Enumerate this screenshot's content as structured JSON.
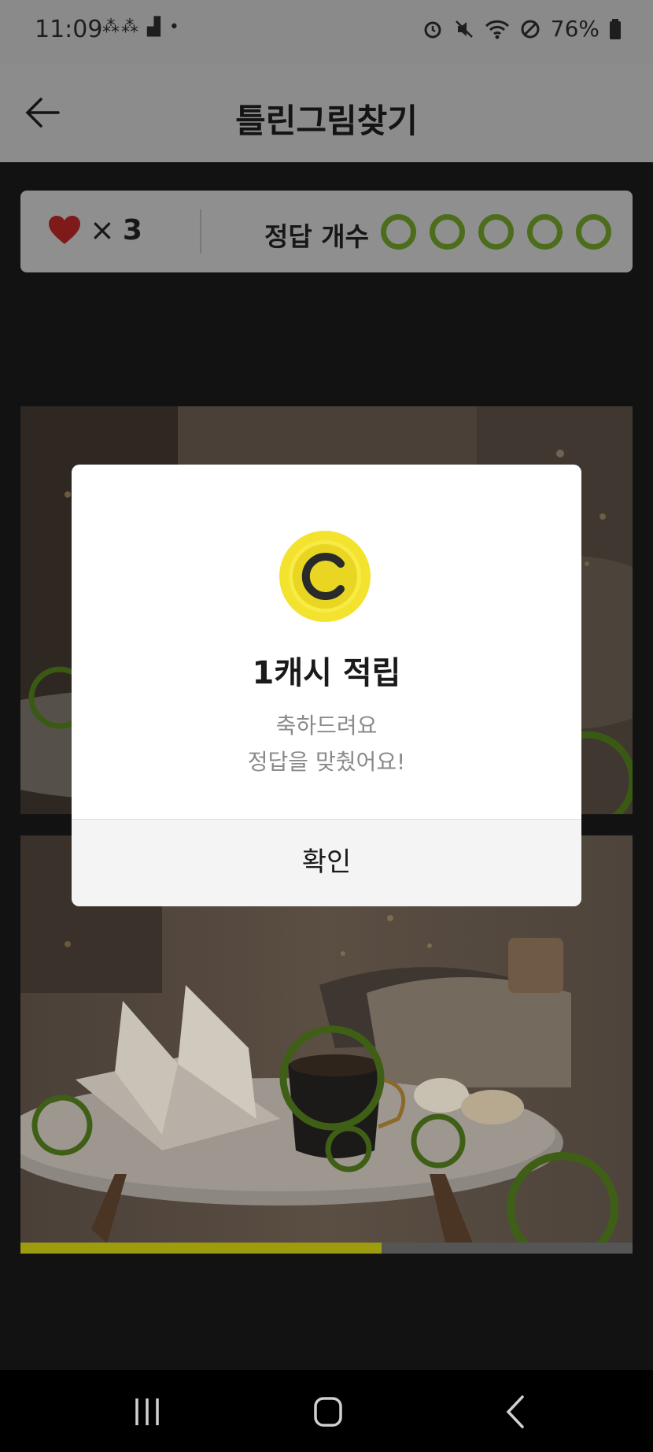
{
  "status_bar": {
    "time": "11:09",
    "left_icons": "⁂⁂ ▟ •",
    "battery": "76%"
  },
  "header": {
    "title": "틀린그림찾기"
  },
  "game_bar": {
    "lives_count": "3",
    "lives_multiplier": "×",
    "answers_label": "정답 개수",
    "answers_total": 5,
    "accent_color": "#4c6e1c"
  },
  "progress": {
    "fraction": 0.59
  },
  "dialog": {
    "coin_letter": "C",
    "title": "1캐시 적립",
    "subtitle_line1": "축하드려요",
    "subtitle_line2": "정답을 맞췄어요!",
    "confirm_label": "확인"
  }
}
